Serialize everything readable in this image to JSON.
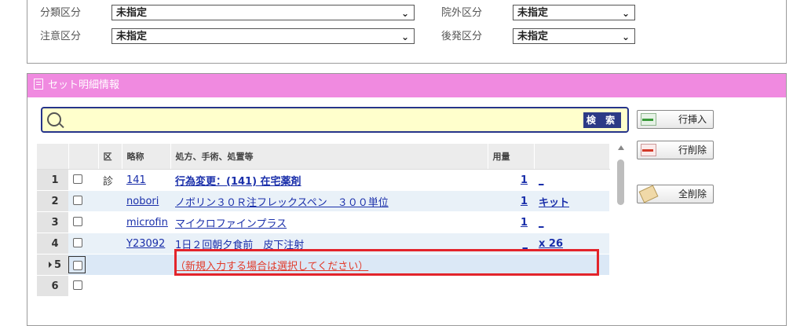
{
  "filters": {
    "row1": {
      "left_label": "分類区分",
      "left_value": "未指定",
      "right_label": "院外区分",
      "right_value": "未指定"
    },
    "row2": {
      "left_label": "注意区分",
      "left_value": "未指定",
      "right_label": "後発区分",
      "right_value": "未指定"
    }
  },
  "set_detail": {
    "title": "セット明細情報",
    "search_button": "検 索",
    "buttons": {
      "insert_row": "行挿入",
      "delete_row": "行削除",
      "delete_all": "全削除"
    },
    "columns": {
      "kubun": "区",
      "abbr": "略称",
      "treatment": "処方、手術、処置等",
      "dose": "用量"
    },
    "rows": [
      {
        "no": "1",
        "kubun": "診",
        "abbr": "141",
        "treatment": "行為変更：(141) 在宅薬剤",
        "dose": "1",
        "unit": "_"
      },
      {
        "no": "2",
        "kubun": "",
        "abbr": "nobori",
        "treatment": "ノボリン３０Ｒ注フレックスペン　３００単位",
        "dose": "1",
        "unit": "キット"
      },
      {
        "no": "3",
        "kubun": "",
        "abbr": "microfin",
        "treatment": "マイクロファインプラス",
        "dose": "1",
        "unit": "_"
      },
      {
        "no": "4",
        "kubun": "",
        "abbr": "Y23092",
        "treatment": "1日２回朝夕食前　皮下注射",
        "dose": "_",
        "unit": "x 26"
      },
      {
        "no": "5",
        "kubun": "",
        "abbr": "",
        "treatment": "（新規入力する場合は選択してください）",
        "dose": "",
        "unit": ""
      },
      {
        "no": "6",
        "kubun": "",
        "abbr": "",
        "treatment": "",
        "dose": "",
        "unit": ""
      }
    ]
  },
  "colors": {
    "header_pink": "#f08ae0",
    "search_bg": "#ffffcc",
    "search_border": "#26348a",
    "highlight_red": "#e3242b"
  }
}
